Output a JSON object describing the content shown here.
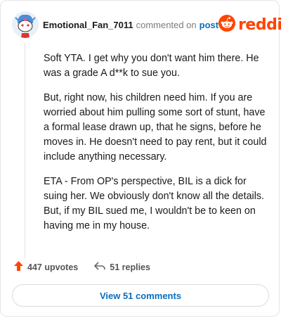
{
  "header": {
    "username": "Emotional_Fan_7011",
    "commented_text": "commented on",
    "post_link": "post",
    "logo_text": "reddit"
  },
  "comment": {
    "paragraphs": [
      "Soft YTA. I get why you don't want him there. He was a grade A d**k to sue you.",
      "But, right now, his children need him. If you are worried about him pulling some sort of stunt, have a formal lease drawn up, that he signs, before he moves in. He doesn't need to pay rent, but it could include anything necessary.",
      "ETA - From OP's perspective, BIL is a dick for suing her. We obviously don't know all the details. But, if my BIL sued me, I wouldn't be to keen on having me in my house."
    ]
  },
  "actions": {
    "upvotes": "447 upvotes",
    "replies": "51 replies"
  },
  "footer": {
    "view_comments": "View 51 comments"
  },
  "colors": {
    "brand": "#ff4500",
    "link": "#0a6ebd",
    "muted": "#7c7c7c"
  },
  "icons": {
    "avatar": "snoo-avatar-icon",
    "logo": "reddit-snoo-icon",
    "upvote": "upvote-arrow-icon",
    "reply": "reply-arrow-icon"
  }
}
